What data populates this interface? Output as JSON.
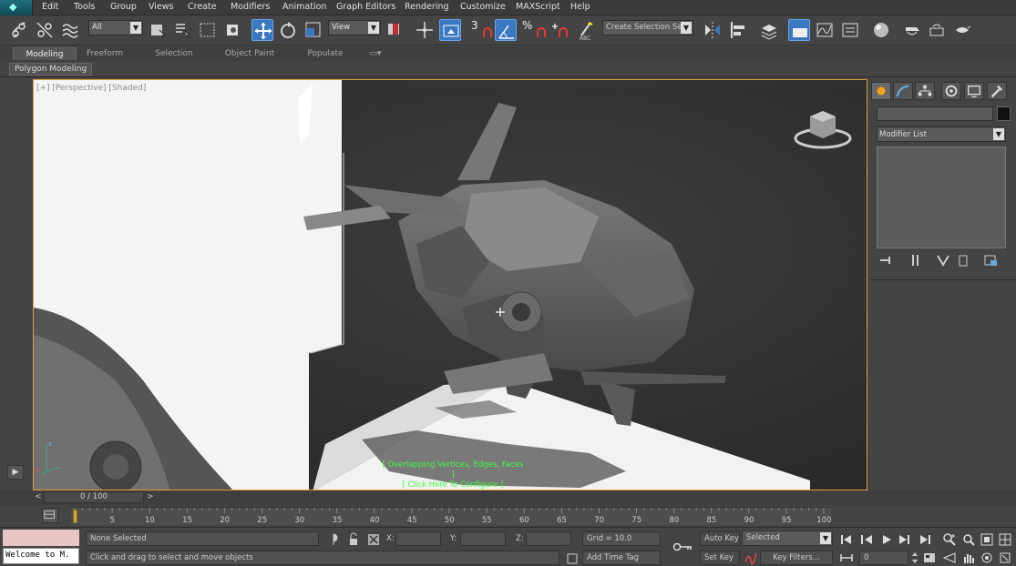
{
  "menu": {
    "items": [
      "Edit",
      "Tools",
      "Group",
      "Views",
      "Create",
      "Modifiers",
      "Animation",
      "Graph Editors",
      "Rendering",
      "Customize",
      "MAXScript",
      "Help"
    ]
  },
  "toolbar": {
    "selection_filter": "All",
    "reference_coord": "View",
    "angle_snap": "3",
    "percent_snap": "%",
    "selection_set_placeholder": "Create Selection Se"
  },
  "ribbon": {
    "tabs": [
      "Modeling",
      "Freeform",
      "Selection",
      "Object Paint",
      "Populate"
    ],
    "active_tab": "Modeling",
    "panel": "Polygon Modeling"
  },
  "viewport": {
    "label": "[+] [Perspective] [Shaded]",
    "overlay_line1": "[ Overlapping Vertices, Edges, Faces ]",
    "overlay_line2": "[ Click Here To Configure ]"
  },
  "command_panel": {
    "modifier_list": "Modifier List"
  },
  "timeline": {
    "slider": "0 / 100",
    "ticks": [
      "5",
      "10",
      "15",
      "20",
      "25",
      "30",
      "35",
      "40",
      "45",
      "50",
      "55",
      "60",
      "65",
      "70",
      "75",
      "80",
      "85",
      "90",
      "95",
      "100"
    ]
  },
  "status": {
    "selection": "None Selected",
    "prompt": "Click and drag to select and move objects",
    "x_label": "X:",
    "y_label": "Y:",
    "z_label": "Z:",
    "grid": "Grid = 10.0",
    "add_time_tag": "Add Time Tag",
    "auto_key": "Auto Key",
    "set_key": "Set Key",
    "key_mode": "Selected",
    "key_filters": "Key Filters...",
    "frame": "0",
    "listener": "Welcome to M."
  },
  "colors": {
    "accent": "#3a78c2",
    "viewport_border": "#d7a335",
    "overlay_text": "#3cff3c"
  }
}
